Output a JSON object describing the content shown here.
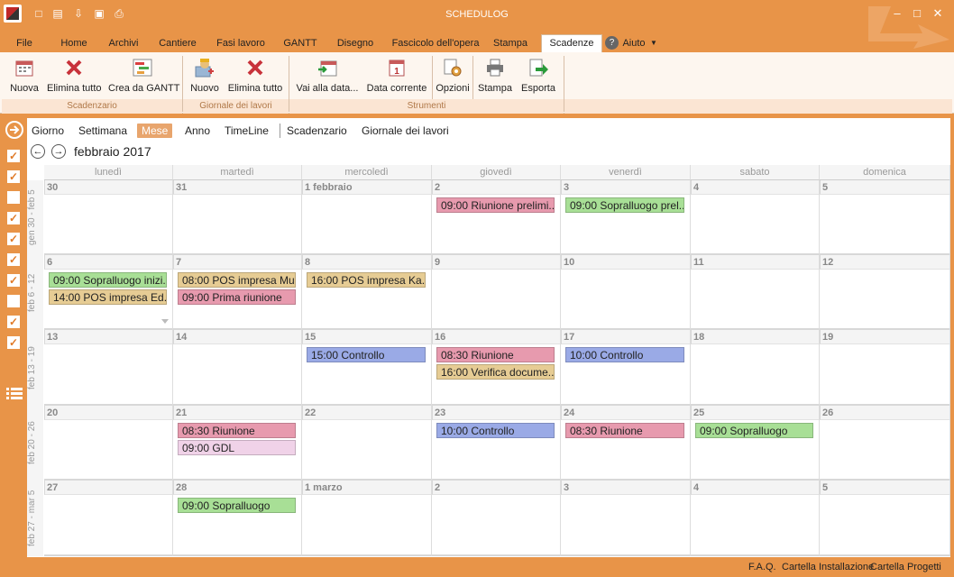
{
  "app": {
    "title": "SCHEDULOG"
  },
  "menu": {
    "tabs": [
      "File",
      "Home",
      "Archivi",
      "Cantiere",
      "Fasi lavoro",
      "GANTT",
      "Disegno",
      "Fascicolo dell'opera",
      "Stampa",
      "Scadenze"
    ],
    "active": "Scadenze",
    "help": "Aiuto"
  },
  "ribbon": {
    "groups": [
      "Scadenzario",
      "Giornale dei lavori",
      "Strumenti"
    ],
    "buttons": {
      "nuova": "Nuova",
      "elimina_tutto_1": "Elimina tutto",
      "crea_gantt": "Crea da GANTT",
      "nuovo": "Nuovo",
      "elimina_tutto_2": "Elimina tutto",
      "vai_data": "Vai alla data...",
      "data_corrente": "Data corrente",
      "opzioni": "Opzioni",
      "stampa": "Stampa",
      "esporta": "Esporta"
    }
  },
  "leftbar": {
    "checks": [
      true,
      true,
      false,
      true,
      true,
      true,
      true,
      false,
      true,
      true
    ]
  },
  "views": [
    "Giorno",
    "Settimana",
    "Mese",
    "Anno",
    "TimeLine",
    "Scadenzario",
    "Giornale dei lavori"
  ],
  "active_view": "Mese",
  "calendar": {
    "month_title": "febbraio 2017",
    "day_headers": [
      "lunedì",
      "martedì",
      "mercoledì",
      "giovedì",
      "venerdì",
      "sabato",
      "domenica"
    ],
    "weeks": [
      {
        "label": "gen 30 - feb 5",
        "days": [
          "30",
          "31",
          "1 febbraio",
          "2",
          "3",
          "4",
          "5"
        ]
      },
      {
        "label": "feb 6 - 12",
        "days": [
          "6",
          "7",
          "8",
          "9",
          "10",
          "11",
          "12"
        ]
      },
      {
        "label": "feb 13 - 19",
        "days": [
          "13",
          "14",
          "15",
          "16",
          "17",
          "18",
          "19"
        ]
      },
      {
        "label": "feb 20 - 26",
        "days": [
          "20",
          "21",
          "22",
          "23",
          "24",
          "25",
          "26"
        ]
      },
      {
        "label": "feb 27 - mar 5",
        "days": [
          "27",
          "28",
          "1 marzo",
          "2",
          "3",
          "4",
          "5"
        ]
      }
    ],
    "events": [
      {
        "week": 0,
        "day": 3,
        "slot": 0,
        "text": "09:00 Riunione prelimi...",
        "color": "#e79aae"
      },
      {
        "week": 0,
        "day": 4,
        "slot": 0,
        "text": "09:00 Sopralluogo prel...",
        "color": "#a8df96"
      },
      {
        "week": 1,
        "day": 0,
        "slot": 0,
        "text": "09:00 Sopralluogo inizi...",
        "color": "#a8df96"
      },
      {
        "week": 1,
        "day": 0,
        "slot": 1,
        "text": "14:00 POS impresa Ed...",
        "color": "#e6cc94"
      },
      {
        "week": 1,
        "day": 1,
        "slot": 0,
        "text": "08:00 POS impresa Mu...",
        "color": "#e6cc94"
      },
      {
        "week": 1,
        "day": 1,
        "slot": 1,
        "text": "09:00 Prima riunione",
        "color": "#e79aae"
      },
      {
        "week": 1,
        "day": 2,
        "slot": 0,
        "text": "16:00 POS impresa Ka...",
        "color": "#e6cc94"
      },
      {
        "week": 2,
        "day": 2,
        "slot": 0,
        "text": "15:00 Controllo",
        "color": "#9aaae6"
      },
      {
        "week": 2,
        "day": 3,
        "slot": 0,
        "text": "08:30 Riunione",
        "color": "#e79aae"
      },
      {
        "week": 2,
        "day": 3,
        "slot": 1,
        "text": "16:00 Verifica docume...",
        "color": "#e6cc94"
      },
      {
        "week": 2,
        "day": 4,
        "slot": 0,
        "text": "10:00 Controllo",
        "color": "#9aaae6"
      },
      {
        "week": 3,
        "day": 1,
        "slot": 0,
        "text": "08:30 Riunione",
        "color": "#e79aae"
      },
      {
        "week": 3,
        "day": 1,
        "slot": 1,
        "text": "09:00 GDL",
        "color": "#f0d2e8"
      },
      {
        "week": 3,
        "day": 3,
        "slot": 0,
        "text": "10:00 Controllo",
        "color": "#9aaae6"
      },
      {
        "week": 3,
        "day": 4,
        "slot": 0,
        "text": "08:30 Riunione",
        "color": "#e79aae"
      },
      {
        "week": 3,
        "day": 5,
        "slot": 0,
        "text": "09:00 Sopralluogo",
        "color": "#a8df96"
      },
      {
        "week": 4,
        "day": 1,
        "slot": 0,
        "text": "09:00 Sopralluogo",
        "color": "#a8df96"
      }
    ]
  },
  "status": {
    "links": [
      "F.A.Q.",
      "Cartella Installazione",
      "Cartella Progetti"
    ]
  }
}
